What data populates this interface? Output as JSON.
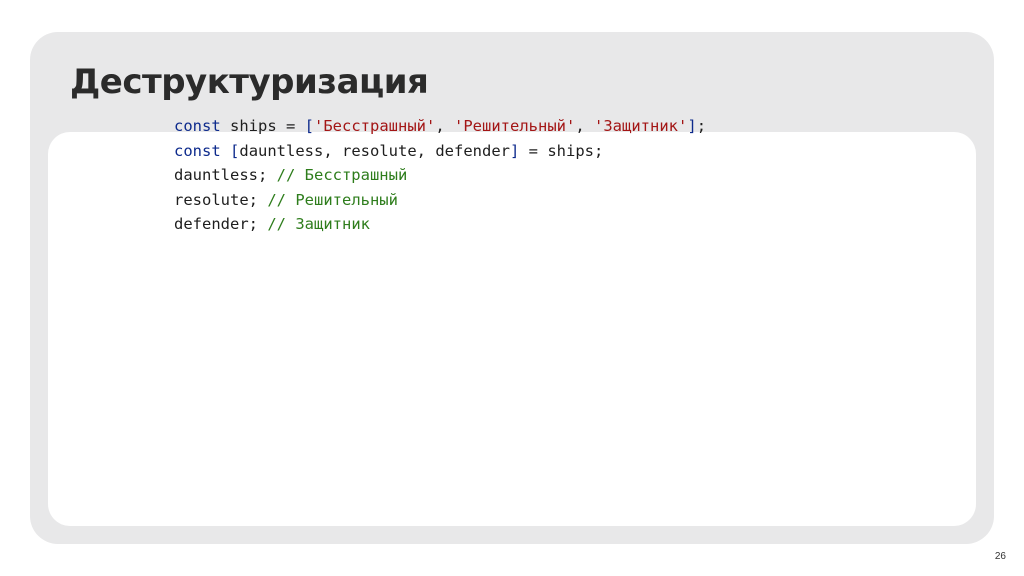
{
  "slide": {
    "title": "Деструктуризация",
    "page_number": "26"
  },
  "code": {
    "line1": [
      {
        "text": "const",
        "kind": "kw"
      },
      {
        "text": " ships = ",
        "kind": "plain"
      },
      {
        "text": "[",
        "kind": "br"
      },
      {
        "text": "'Бесстрашный'",
        "kind": "str"
      },
      {
        "text": ", ",
        "kind": "plain"
      },
      {
        "text": "'Решительный'",
        "kind": "str"
      },
      {
        "text": ", ",
        "kind": "plain"
      },
      {
        "text": "'Защитник'",
        "kind": "str"
      },
      {
        "text": "]",
        "kind": "br"
      },
      {
        "text": ";",
        "kind": "plain"
      }
    ],
    "line2": [
      {
        "text": "const",
        "kind": "kw"
      },
      {
        "text": " ",
        "kind": "plain"
      },
      {
        "text": "[",
        "kind": "br"
      },
      {
        "text": "dauntless, resolute, defender",
        "kind": "plain"
      },
      {
        "text": "]",
        "kind": "br"
      },
      {
        "text": " = ships;",
        "kind": "plain"
      }
    ],
    "line3": [
      {
        "text": "dauntless; ",
        "kind": "plain"
      },
      {
        "text": "// Бесстрашный",
        "kind": "cm"
      }
    ],
    "line4": [
      {
        "text": "resolute; ",
        "kind": "plain"
      },
      {
        "text": "// Решительный",
        "kind": "cm"
      }
    ],
    "line5": [
      {
        "text": "defender; ",
        "kind": "plain"
      },
      {
        "text": "// Защитник",
        "kind": "cm"
      }
    ]
  }
}
